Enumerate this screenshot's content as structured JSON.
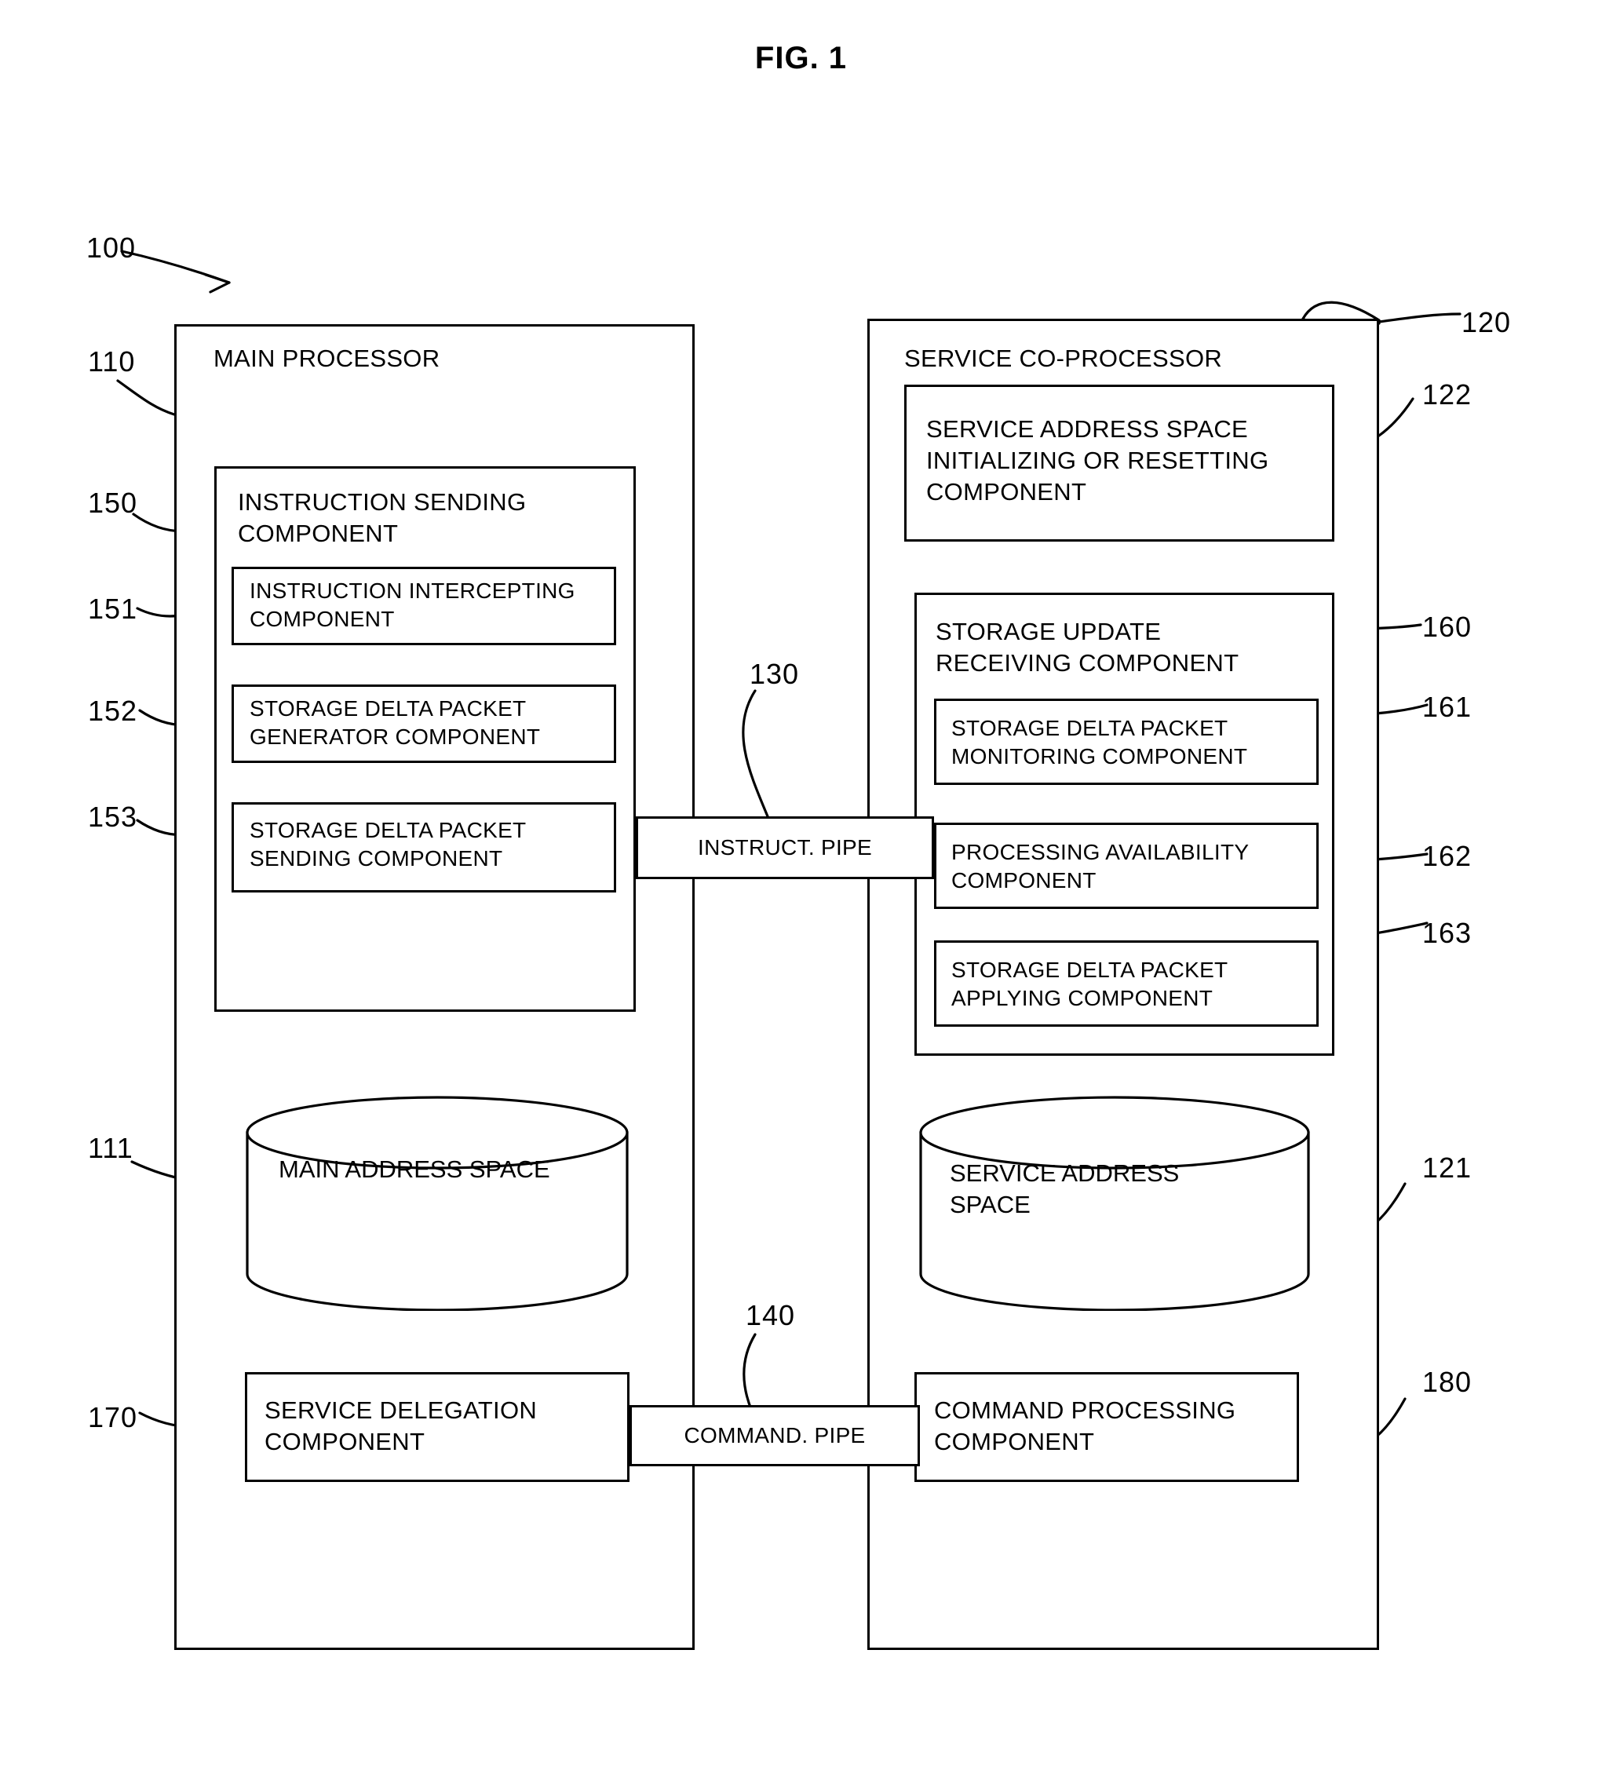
{
  "figure": {
    "title": "FIG. 1",
    "system_ref": "100"
  },
  "main_processor": {
    "ref": "110",
    "title": "MAIN PROCESSOR",
    "instruction_sending": {
      "ref": "150",
      "title": "INSTRUCTION SENDING\nCOMPONENT",
      "children": [
        {
          "ref": "151",
          "label": "INSTRUCTION INTERCEPTING\nCOMPONENT"
        },
        {
          "ref": "152",
          "label": "STORAGE DELTA PACKET\nGENERATOR COMPONENT"
        },
        {
          "ref": "153",
          "label": "STORAGE DELTA PACKET\nSENDING COMPONENT"
        }
      ]
    },
    "main_address_space": {
      "ref": "111",
      "label": "MAIN ADDRESS SPACE"
    },
    "service_delegation": {
      "ref": "170",
      "label": "SERVICE DELEGATION\nCOMPONENT"
    }
  },
  "service_coprocessor": {
    "ref": "120",
    "title": "SERVICE CO-PROCESSOR",
    "address_space_init": {
      "ref": "122",
      "label": "SERVICE ADDRESS SPACE\nINITIALIZING OR RESETTING\nCOMPONENT"
    },
    "storage_update_receiving": {
      "ref": "160",
      "title": "STORAGE UPDATE\nRECEIVING COMPONENT",
      "children": [
        {
          "ref": "161",
          "label": "STORAGE DELTA PACKET\nMONITORING COMPONENT"
        },
        {
          "ref": "162",
          "label": "PROCESSING AVAILABILITY\nCOMPONENT"
        },
        {
          "ref": "163",
          "label": "STORAGE DELTA PACKET\nAPPLYING COMPONENT"
        }
      ]
    },
    "service_address_space": {
      "ref": "121",
      "label": "SERVICE ADDRESS\nSPACE"
    },
    "command_processing": {
      "ref": "180",
      "label": "COMMAND PROCESSING\nCOMPONENT"
    }
  },
  "pipes": [
    {
      "ref": "130",
      "label": "INSTRUCT. PIPE"
    },
    {
      "ref": "140",
      "label": "COMMAND. PIPE"
    }
  ],
  "colors": {
    "stroke": "#000000",
    "background": "#ffffff"
  }
}
